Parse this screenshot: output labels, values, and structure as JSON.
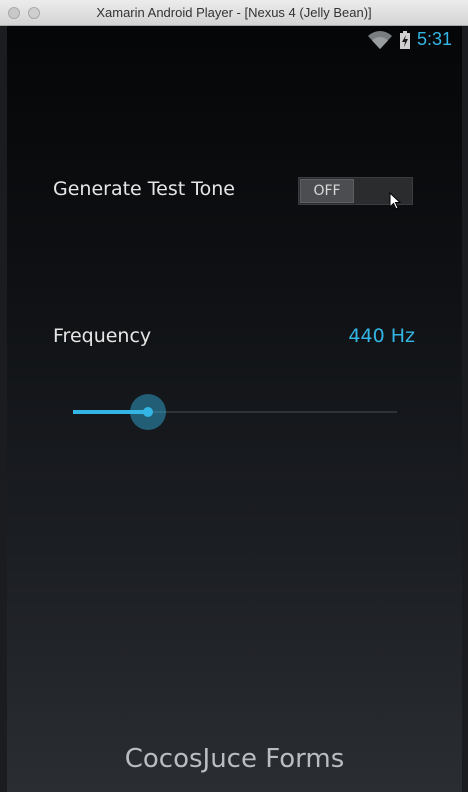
{
  "window": {
    "title": "Xamarin Android Player - [Nexus 4 (Jelly Bean)]"
  },
  "statusbar": {
    "time": "5:31",
    "icons": [
      "wifi-icon",
      "battery-charging-icon"
    ]
  },
  "test_tone": {
    "label": "Generate Test Tone",
    "toggle_state": "OFF"
  },
  "frequency": {
    "label": "Frequency",
    "value": "440 Hz",
    "slider_fraction": 0.23
  },
  "footer": {
    "title": "CocosJuce Forms"
  },
  "colors": {
    "accent": "#33b5e5",
    "text": "#e6e6e6"
  }
}
